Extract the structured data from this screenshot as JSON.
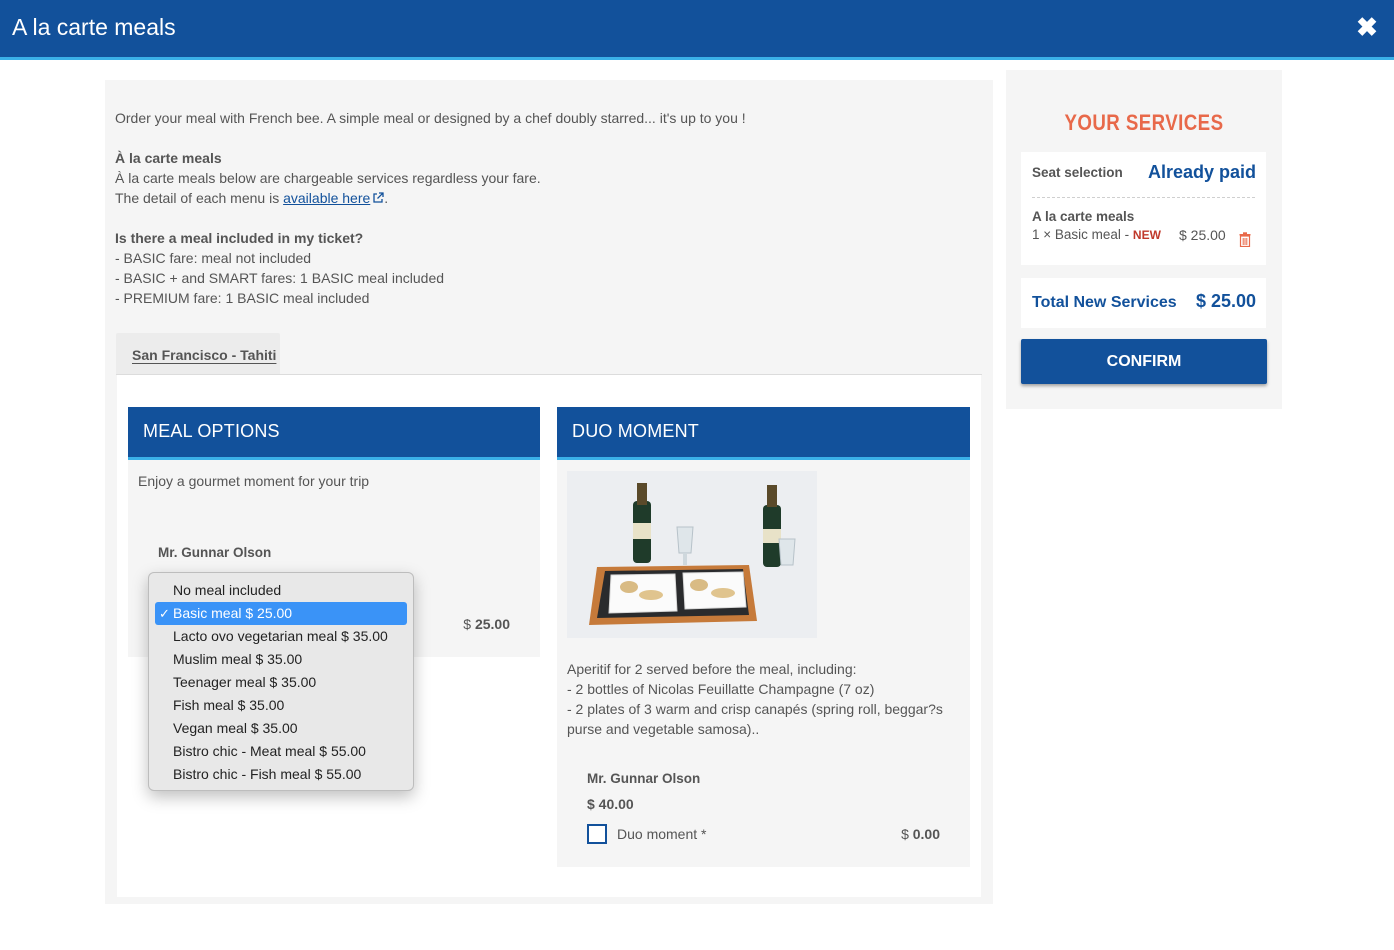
{
  "window": {
    "title": "A la carte meals"
  },
  "intro": {
    "line1": "Order your meal with French bee. A simple meal or designed by a chef doubly starred... it's up to you !",
    "heading1": "À la carte meals",
    "line2": "À la carte meals below are chargeable services regardless your fare.",
    "line3_prefix": "The detail of each menu is ",
    "line3_link": "available here",
    "line3_suffix": ".",
    "heading2": "Is there a meal included in my ticket?",
    "fare1": "- BASIC fare: meal not included",
    "fare2": "- BASIC + and SMART fares: 1 BASIC meal included",
    "fare3": "- PREMIUM fare: 1 BASIC meal included"
  },
  "tabs": [
    {
      "label": "San Francisco - Tahiti"
    }
  ],
  "meal_options": {
    "title": "MEAL OPTIONS",
    "description": "Enjoy a gourmet moment for your trip",
    "passenger": "Mr. Gunnar Olson",
    "price_currency": "$ ",
    "price_value": "25.00"
  },
  "duo_moment": {
    "title": "DUO MOMENT",
    "desc1": "Aperitif for 2 served before the meal, including:",
    "desc2": "- 2 bottles of Nicolas Feuillatte Champagne (7 oz)",
    "desc3": "- 2 plates of 3 warm and crisp canapés (spring roll, beggar?s purse and vegetable samosa)..",
    "passenger": "Mr. Gunnar Olson",
    "price": "$ 40.00",
    "checkbox_label": "Duo moment *",
    "amount_currency": "$ ",
    "amount_value": "0.00"
  },
  "services": {
    "title": "YOUR SERVICES",
    "seat_label": "Seat selection",
    "seat_value": "Already paid",
    "meals_label": "A la carte meals",
    "meal_item": "1 × Basic meal - ",
    "meal_new": "NEW",
    "meal_price": "$ 25.00",
    "total_label": "Total New Services",
    "total_value": "$ 25.00",
    "confirm_label": "CONFIRM"
  },
  "meal_dropdown": {
    "selected_index": 1,
    "options": [
      "No meal included",
      "Basic meal $ 25.00",
      "Lacto ovo vegetarian meal $ 35.00",
      "Muslim meal $ 35.00",
      "Teenager meal $ 35.00",
      "Fish meal $ 35.00",
      "Vegan meal $ 35.00",
      "Bistro chic - Meat meal $ 55.00",
      "Bistro chic - Fish meal $ 55.00"
    ]
  },
  "colors": {
    "brand_blue": "#12519b",
    "accent_cyan": "#3ab0e8",
    "services_orange": "#e8694a",
    "new_red": "#c0392b",
    "selection_blue": "#3a93f7"
  },
  "icons": {
    "close": "close-icon",
    "external_link": "external-link-icon",
    "trash": "trash-icon",
    "checkmark": "checkmark-icon"
  }
}
